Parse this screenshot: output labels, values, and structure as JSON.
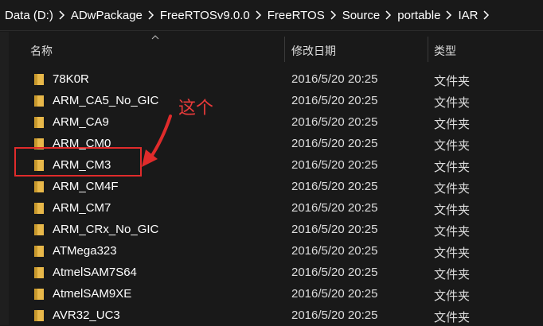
{
  "breadcrumb": [
    "Data (D:)",
    "ADwPackage",
    "FreeRTOSv9.0.0",
    "FreeRTOS",
    "Source",
    "portable",
    "IAR"
  ],
  "columns": {
    "name": "名称",
    "date": "修改日期",
    "type": "类型"
  },
  "rows": [
    {
      "name": "78K0R",
      "date": "2016/5/20 20:25",
      "type": "文件夹"
    },
    {
      "name": "ARM_CA5_No_GIC",
      "date": "2016/5/20 20:25",
      "type": "文件夹"
    },
    {
      "name": "ARM_CA9",
      "date": "2016/5/20 20:25",
      "type": "文件夹"
    },
    {
      "name": "ARM_CM0",
      "date": "2016/5/20 20:25",
      "type": "文件夹"
    },
    {
      "name": "ARM_CM3",
      "date": "2016/5/20 20:25",
      "type": "文件夹"
    },
    {
      "name": "ARM_CM4F",
      "date": "2016/5/20 20:25",
      "type": "文件夹"
    },
    {
      "name": "ARM_CM7",
      "date": "2016/5/20 20:25",
      "type": "文件夹"
    },
    {
      "name": "ARM_CRx_No_GIC",
      "date": "2016/5/20 20:25",
      "type": "文件夹"
    },
    {
      "name": "ATMega323",
      "date": "2016/5/20 20:25",
      "type": "文件夹"
    },
    {
      "name": "AtmelSAM7S64",
      "date": "2016/5/20 20:25",
      "type": "文件夹"
    },
    {
      "name": "AtmelSAM9XE",
      "date": "2016/5/20 20:25",
      "type": "文件夹"
    },
    {
      "name": "AVR32_UC3",
      "date": "2016/5/20 20:25",
      "type": "文件夹"
    }
  ],
  "annotation": {
    "text": "这个",
    "color": "#e02b2b"
  },
  "icons": {
    "folder": "folder-icon",
    "separator": "chevron-right-icon",
    "sort": "sort-up-icon"
  },
  "colors": {
    "background": "#191919",
    "folder": "#e8b84a"
  }
}
